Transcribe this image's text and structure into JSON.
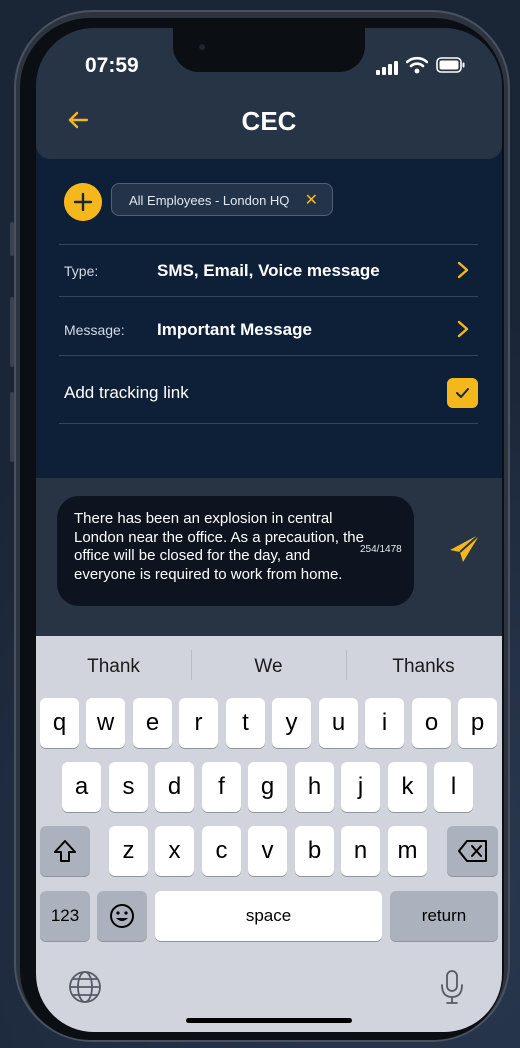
{
  "status_bar": {
    "time": "07:59"
  },
  "header": {
    "title": "CEC"
  },
  "recipients": {
    "chip_label": "All Employees - London HQ"
  },
  "form": {
    "type_label": "Type:",
    "type_value": "SMS, Email, Voice message",
    "message_label": "Message:",
    "message_value": "Important Message",
    "tracking_label": "Add tracking link",
    "tracking_checked": true
  },
  "compose": {
    "text": "There has been an explosion in central London near the office. As a precaution, the office will be closed for the day, and everyone is required to work from home.",
    "counter": "254/1478"
  },
  "keyboard": {
    "suggestions": [
      "Thank",
      "We",
      "Thanks"
    ],
    "row1": [
      "q",
      "w",
      "e",
      "r",
      "t",
      "y",
      "u",
      "i",
      "o",
      "p"
    ],
    "row2": [
      "a",
      "s",
      "d",
      "f",
      "g",
      "h",
      "j",
      "k",
      "l"
    ],
    "row3": [
      "z",
      "x",
      "c",
      "v",
      "b",
      "n",
      "m"
    ],
    "numbers_label": "123",
    "space_label": "space",
    "return_label": "return"
  },
  "colors": {
    "accent": "#f5b81c",
    "header_bg": "#263446",
    "form_bg": "#0e2038"
  },
  "icons": [
    "back-arrow-icon",
    "plus-icon",
    "close-icon",
    "chevron-right-icon",
    "checkmark-icon",
    "send-icon",
    "shift-icon",
    "backspace-icon",
    "emoji-icon",
    "globe-icon",
    "microphone-icon",
    "signal-icon",
    "wifi-icon",
    "battery-icon"
  ]
}
